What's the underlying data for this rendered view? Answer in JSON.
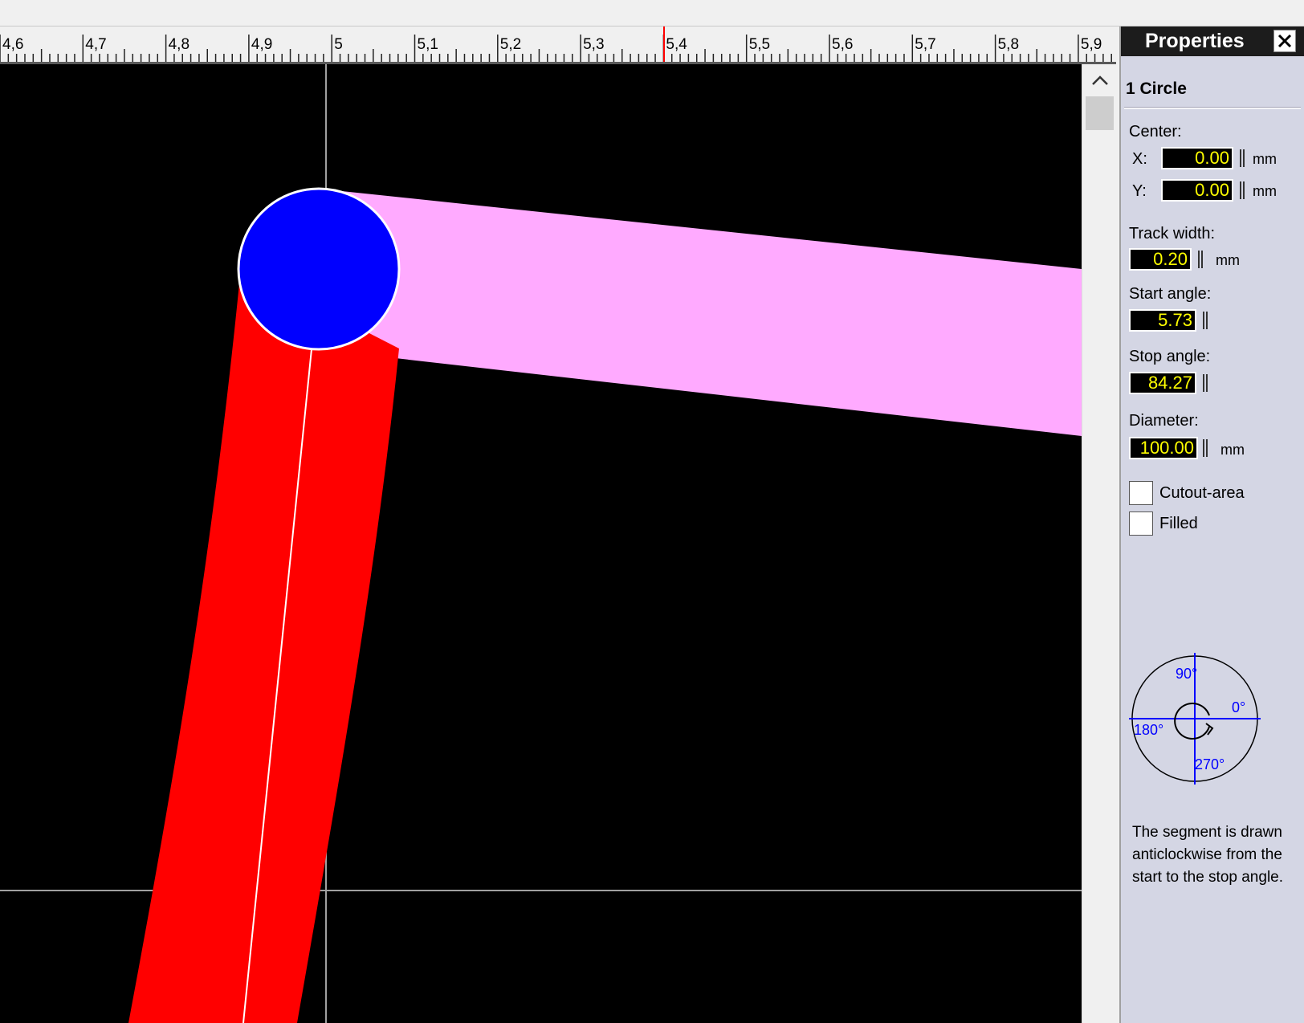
{
  "ruler": {
    "labels": [
      "4,6",
      "4,7",
      "4,8",
      "4,9",
      "5",
      "5,1",
      "5,2",
      "5,3",
      "5,4",
      "5,5",
      "5,6",
      "5,7",
      "5,8",
      "5,9"
    ]
  },
  "panel": {
    "title": "Properties",
    "object_name": "1 Circle",
    "center_label": "Center:",
    "x_label": "X:",
    "x_value": "0.00",
    "y_label": "Y:",
    "y_value": "0.00",
    "unit": "mm",
    "track_width_label": "Track width:",
    "track_width_value": "0.20",
    "start_angle_label": "Start angle:",
    "start_angle_value": "5.73",
    "stop_angle_label": "Stop angle:",
    "stop_angle_value": "84.27",
    "diameter_label": "Diameter:",
    "diameter_value": "100.00",
    "cutout_label": "Cutout-area",
    "cutout_checked": false,
    "filled_label": "Filled",
    "filled_checked": false,
    "diagram": {
      "label_90": "90°",
      "label_0": "0°",
      "label_180": "180°",
      "label_270": "270°"
    },
    "help_text": "The segment is drawn anticlockwise from the start to the stop angle."
  },
  "colors": {
    "canvas_bg": "#000000",
    "pad_blue": "#0000ff",
    "track_pink": "#ffaaff",
    "track_red": "#ff0000",
    "value_text": "#ffff00",
    "panel_bg": "#d4d6e4",
    "diagram_blue": "#0000ff"
  }
}
